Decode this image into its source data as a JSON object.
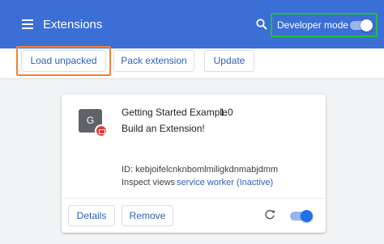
{
  "header": {
    "title": "Extensions",
    "menu_icon": "hamburger-menu-icon",
    "search_icon": "search-icon",
    "developer_mode_label": "Developer mode",
    "developer_mode_on": true
  },
  "toolbar": {
    "load_unpacked_label": "Load unpacked",
    "pack_extension_label": "Pack extension",
    "update_label": "Update"
  },
  "extension": {
    "icon_letter": "G",
    "name": "Getting Started Example",
    "version": "1.0",
    "description": "Build an Extension!",
    "id_text": "ID: kebjoifelcnknbomlmiligkdnmabjdmm",
    "inspect_label": "Inspect views",
    "inspect_link": "service worker (Inactive)",
    "details_label": "Details",
    "remove_label": "Remove",
    "reload_icon": "reload-icon",
    "enabled": true
  },
  "colors": {
    "header_bg": "#3b6fd6",
    "accent_blue": "#1a73e8",
    "link_blue": "#2f5fb8",
    "highlight_green": "#22c03a",
    "highlight_orange": "#f0823a"
  }
}
